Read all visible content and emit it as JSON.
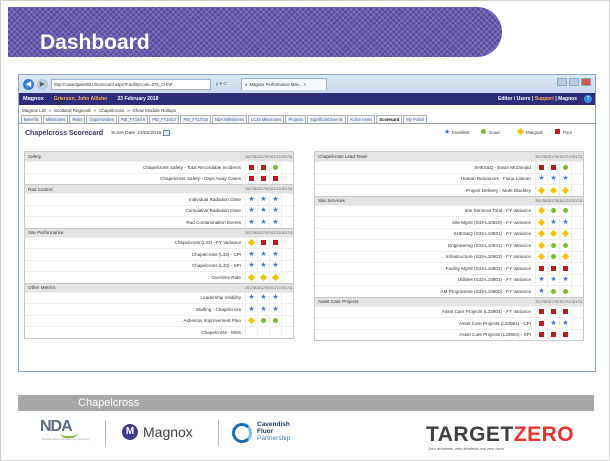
{
  "slide": {
    "title": "Dashboard",
    "footer_label": "Chapelcross"
  },
  "browser": {
    "url": "http://cowedgwe8831/Scorecard.aspx?FacilityCode=375_CHAP",
    "url_controls": "ρ ▾ C",
    "tab_title": "Magnox Performance Man... ×"
  },
  "app": {
    "name": "Magnox",
    "user": "Grierson, John Allister",
    "date": "23 February 2018",
    "right_prefix": "Editor / Users",
    "right_support": "Support",
    "right_sep": "|",
    "right_suffix": "Magnox",
    "help_icon_label": "?"
  },
  "breadcrumb": [
    "Magnox Ltd",
    "Scotland Regional",
    "Chapelcross",
    "Show Module Rollups"
  ],
  "breadcrumb_sep": "»",
  "tabs": [
    {
      "label": "Benefits",
      "active": false
    },
    {
      "label": "Milestones",
      "active": false
    },
    {
      "label": "Risks",
      "active": false
    },
    {
      "label": "Opportunities",
      "active": false
    },
    {
      "label": "PBI_FY15/16",
      "active": false
    },
    {
      "label": "PBI_FY16/17",
      "active": false
    },
    {
      "label": "PBI_FY17/18",
      "active": false
    },
    {
      "label": "NDA Milestones",
      "active": false
    },
    {
      "label": "LC35 Milestones",
      "active": false
    },
    {
      "label": "Projects",
      "active": false
    },
    {
      "label": "Significant Events",
      "active": false
    },
    {
      "label": "Action Items",
      "active": false
    },
    {
      "label": "Scorecard",
      "active": true
    },
    {
      "label": "My Portal",
      "active": false
    }
  ],
  "scorecard": {
    "title": "Chapelcross Scorecard",
    "date_label": "Score Date",
    "date_value": "23/02/2018",
    "legend": [
      {
        "label": "Excellent",
        "symbol": "star"
      },
      {
        "label": "Good",
        "symbol": "circle"
      },
      {
        "label": "Marginal",
        "symbol": "diamond"
      },
      {
        "label": "Poor",
        "symbol": "square"
      }
    ],
    "columns": [
      "201708",
      "201709",
      "201710",
      "201711"
    ],
    "left_sections": [
      {
        "name": "Safety",
        "rows": [
          {
            "label": "Chapelcross Safety - Total Recordable Incidents",
            "marks": [
              "square",
              "square",
              "circle",
              ""
            ]
          },
          {
            "label": "Chapelcross Safety - Days Away Cases",
            "marks": [
              "square",
              "square",
              "square",
              ""
            ]
          }
        ]
      },
      {
        "name": "Rad Control",
        "rows": [
          {
            "label": "Individual Radiation Dose",
            "marks": [
              "star",
              "star",
              "star",
              ""
            ]
          },
          {
            "label": "Cumulative Radiation Dose",
            "marks": [
              "star",
              "star",
              "star",
              ""
            ]
          },
          {
            "label": "Rad Contamination Events",
            "marks": [
              "star",
              "star",
              "star",
              ""
            ]
          }
        ]
      },
      {
        "name": "Site Performance",
        "rows": [
          {
            "label": "Chapelcross (L33) - FY Variance",
            "marks": [
              "diamond",
              "square",
              "square",
              ""
            ]
          },
          {
            "label": "Chapelcross (L33) - CPI",
            "marks": [
              "star",
              "star",
              "star",
              ""
            ]
          },
          {
            "label": "Chapelcross (L33) - SPI",
            "marks": [
              "star",
              "star",
              "star",
              ""
            ]
          },
          {
            "label": "Overtime Rate",
            "marks": [
              "diamond",
              "diamond",
              "diamond",
              ""
            ]
          }
        ]
      },
      {
        "name": "Other Metrics",
        "rows": [
          {
            "label": "Leadership Visibility",
            "marks": [
              "star",
              "star",
              "star",
              ""
            ]
          },
          {
            "label": "Staffing - Chapelcross",
            "marks": [
              "star",
              "star",
              "star",
              ""
            ]
          },
          {
            "label": "Asbestos Improvement Plan",
            "marks": [
              "diamond",
              "circle",
              "circle",
              ""
            ]
          },
          {
            "label": "Chapelcross - MSS",
            "marks": [
              "",
              "",
              "",
              ""
            ]
          }
        ]
      }
    ],
    "right_sections": [
      {
        "name": "Chapelcross Lead Team",
        "rows": [
          {
            "label": "SHES&Q - Ewan McDonald",
            "marks": [
              "square",
              "square",
              "circle",
              ""
            ]
          },
          {
            "label": "Human Resources - Fiona Latimer",
            "marks": [
              "star",
              "star",
              "star",
              ""
            ]
          },
          {
            "label": "Project Delivery - Mark Blackley",
            "marks": [
              "diamond",
              "diamond",
              "diamond",
              ""
            ]
          }
        ]
      },
      {
        "name": "Site Services",
        "rows": [
          {
            "label": "Site Services Total - FY Variance",
            "marks": [
              "diamond",
              "circle",
              "circle",
              ""
            ]
          },
          {
            "label": "Site Mgmt (S33-L10820) - FY Variance",
            "marks": [
              "diamond",
              "star",
              "star",
              ""
            ]
          },
          {
            "label": "SHES&Q (S33-L10931) - FY Variance",
            "marks": [
              "diamond",
              "diamond",
              "diamond",
              ""
            ]
          },
          {
            "label": "Engineering (S33-L10941) - FY Variance",
            "marks": [
              "diamond",
              "circle",
              "circle",
              ""
            ]
          },
          {
            "label": "Infrastructure (S33-L10803) - FY Variance",
            "marks": [
              "diamond",
              "circle",
              "diamond",
              ""
            ]
          },
          {
            "label": "Facility Mgmt (S33-L10802) - FY Variance",
            "marks": [
              "square",
              "square",
              "square",
              ""
            ]
          },
          {
            "label": "Utilities (S33-L10801) - FY Variance",
            "marks": [
              "star",
              "star",
              "star",
              ""
            ]
          },
          {
            "label": "AM Programme (S33-L10800) - FY Variance",
            "marks": [
              "star",
              "circle",
              "circle",
              ""
            ]
          }
        ]
      },
      {
        "name": "Asset Care Projects",
        "rows": [
          {
            "label": "Asset Care Projects (L33804) - FY Variance",
            "marks": [
              "square",
              "square",
              "square",
              ""
            ]
          },
          {
            "label": "Asset Care Projects (L33804) - CPI",
            "marks": [
              "square",
              "star",
              "star",
              ""
            ]
          },
          {
            "label": "Asset Care Projects (L33804) - SPI",
            "marks": [
              "square",
              "square",
              "square",
              ""
            ]
          }
        ]
      }
    ]
  },
  "logos": {
    "nda": "NDA",
    "nda_sub": "Nuclear Decommissioning Authority",
    "magnox_mark": "M",
    "magnox": "Magnox",
    "cavendish_1": "Cavendish",
    "cavendish_2": "Fluor",
    "cavendish_3": "Partnership",
    "targetzero_1": "TARGET",
    "targetzero_2": "ZERO",
    "targetzero_sub": "Zero accidents, zero incidents and zero harm"
  }
}
